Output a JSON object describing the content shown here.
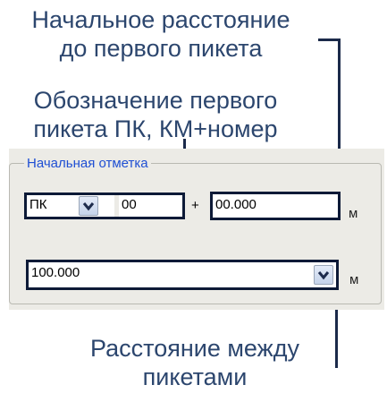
{
  "annotations": {
    "initial_distance": [
      "Начальное расстояние",
      "до первого пикета"
    ],
    "first_picket": [
      "Обозначение первого",
      "пикета ПК, КМ+номер"
    ],
    "picket_spacing": [
      "Расстояние между",
      "пикетами"
    ]
  },
  "group": {
    "legend": "Начальная отметка",
    "prefix_select_value": "ПК",
    "number_value": "00",
    "plus_sign": "+",
    "offset_value": "00.000",
    "unit": "м",
    "spacing_value": "100.000",
    "spacing_unit": "м"
  },
  "colors": {
    "annotation_text": "#2c466e",
    "legend_text": "#1f4fd3",
    "panel_bg": "#ecebe6",
    "highlight_border": "#0d1a37"
  },
  "icons": {
    "dropdown": "chevron-down-icon"
  }
}
